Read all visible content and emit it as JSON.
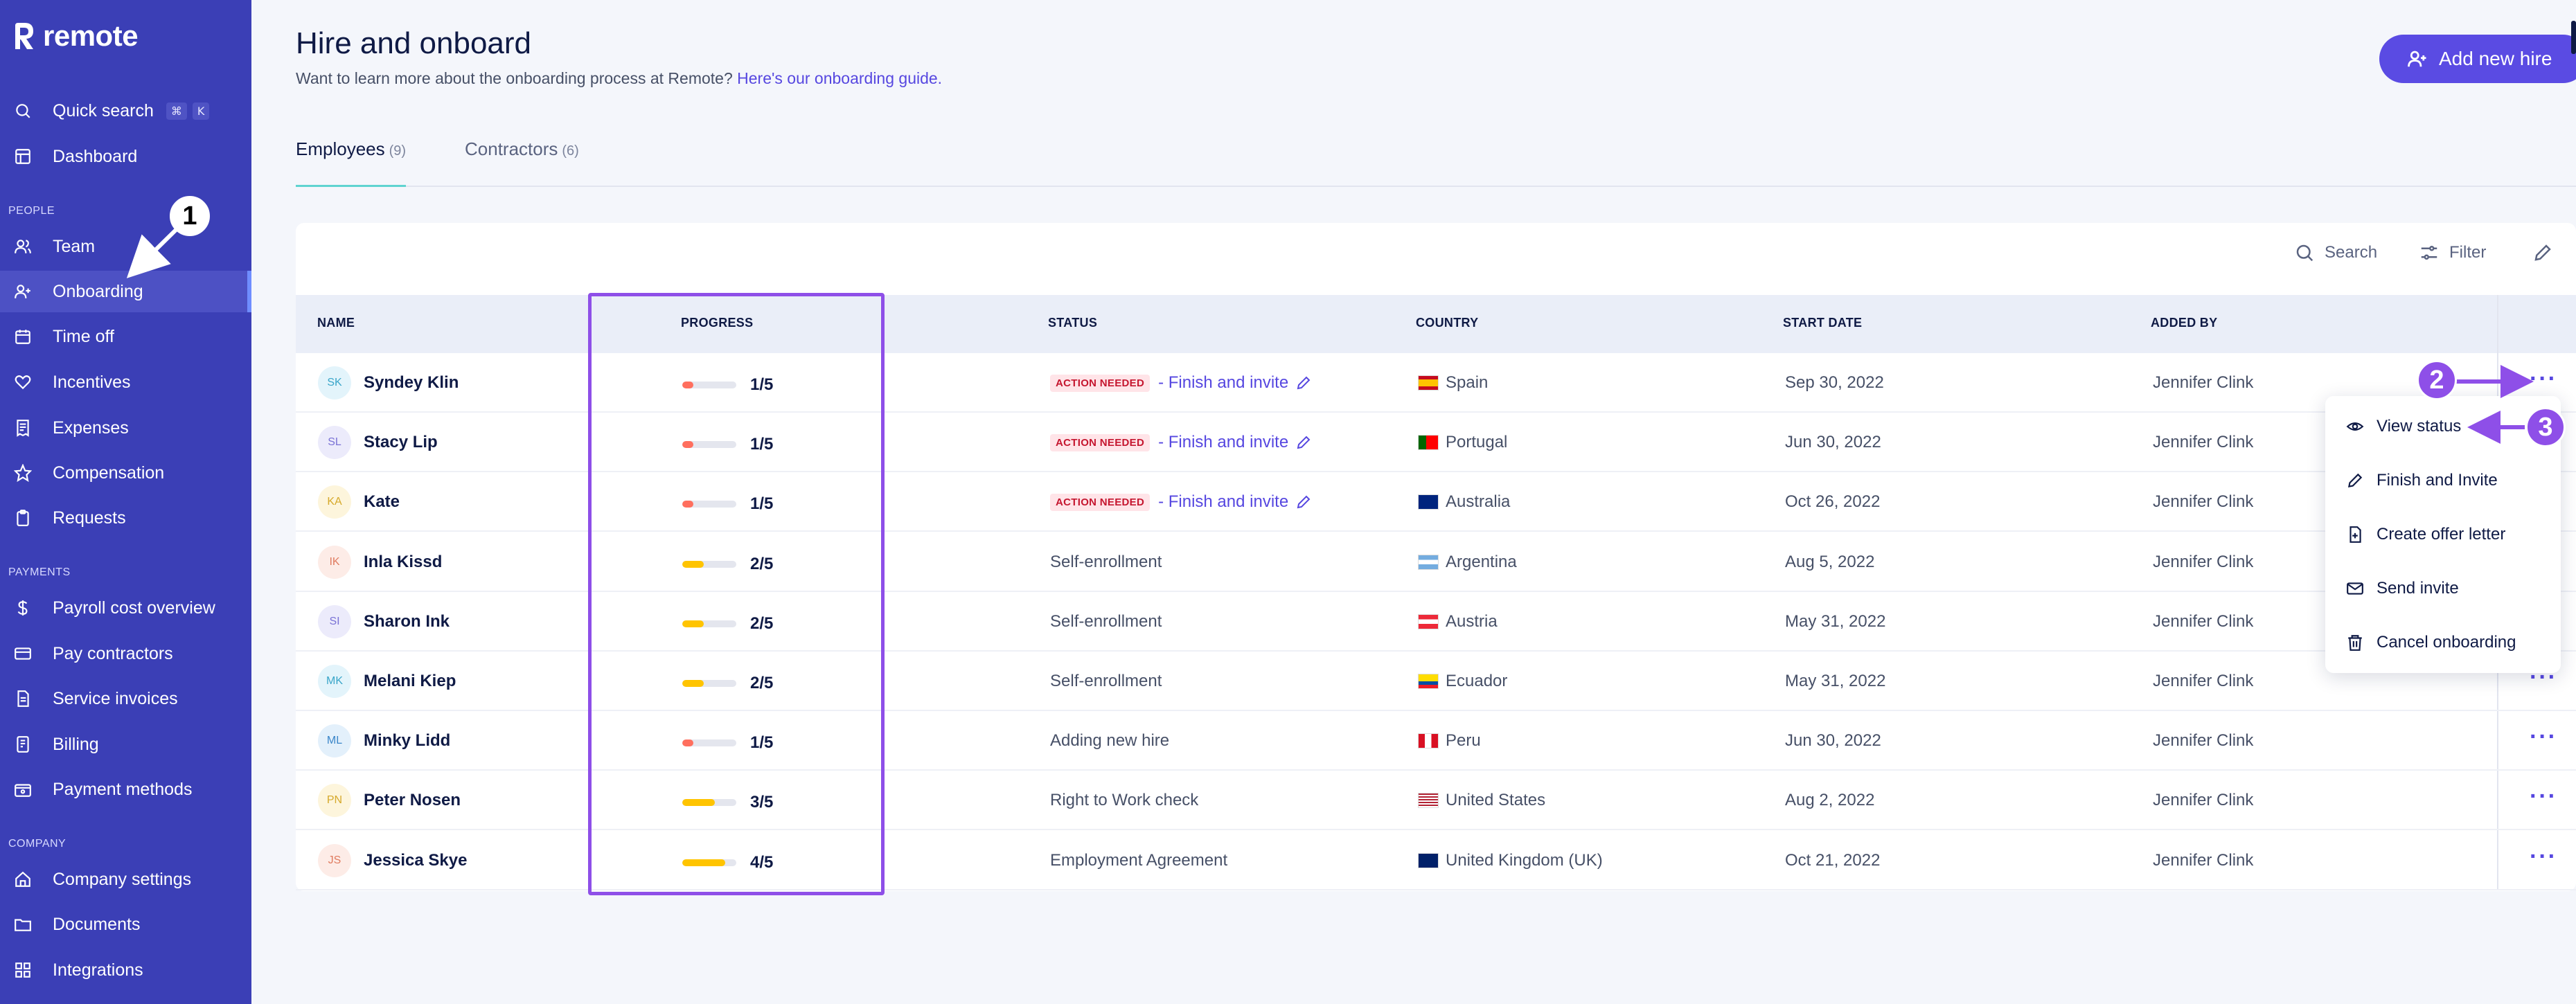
{
  "brand": {
    "name": "remote",
    "sidebar_color": "#3b3fb6",
    "accent": "#5a4be3",
    "annotation_color": "#8e4fe8"
  },
  "sidebar": {
    "quick_search": {
      "label": "Quick search",
      "keys": [
        "⌘",
        "K"
      ],
      "icon": "search-icon"
    },
    "top_items": [
      {
        "label": "Dashboard",
        "icon": "dashboard-icon"
      }
    ],
    "sections": [
      {
        "label": "PEOPLE",
        "items": [
          {
            "label": "Team",
            "icon": "team-icon"
          },
          {
            "label": "Onboarding",
            "icon": "user-plus-icon",
            "active": true
          },
          {
            "label": "Time off",
            "icon": "calendar-icon"
          },
          {
            "label": "Incentives",
            "icon": "heart-icon"
          },
          {
            "label": "Expenses",
            "icon": "receipt-icon"
          },
          {
            "label": "Compensation",
            "icon": "star-icon"
          },
          {
            "label": "Requests",
            "icon": "clipboard-icon"
          }
        ]
      },
      {
        "label": "PAYMENTS",
        "items": [
          {
            "label": "Payroll cost overview",
            "icon": "dollar-icon"
          },
          {
            "label": "Pay contractors",
            "icon": "card-icon"
          },
          {
            "label": "Service invoices",
            "icon": "invoice-icon"
          },
          {
            "label": "Billing",
            "icon": "billing-icon"
          },
          {
            "label": "Payment methods",
            "icon": "wallet-icon"
          }
        ]
      },
      {
        "label": "COMPANY",
        "items": [
          {
            "label": "Company settings",
            "icon": "home-icon"
          },
          {
            "label": "Documents",
            "icon": "folder-icon"
          },
          {
            "label": "Integrations",
            "icon": "grid-icon"
          }
        ]
      }
    ]
  },
  "header": {
    "title": "Hire and onboard",
    "subtitle_text": "Want to learn more about the onboarding process at Remote?",
    "subtitle_link": "Here's our onboarding guide.",
    "add_button": "Add new hire"
  },
  "tabs": [
    {
      "label": "Employees",
      "count": "(9)",
      "active": true
    },
    {
      "label": "Contractors",
      "count": "(6)",
      "active": false
    }
  ],
  "toolbar": {
    "search": "Search",
    "filter": "Filter"
  },
  "table": {
    "columns": [
      "NAME",
      "PROGRESS",
      "STATUS",
      "COUNTRY",
      "START DATE",
      "ADDED BY"
    ],
    "rows": [
      {
        "initials": "SK",
        "name": "Syndey Klin",
        "progress": "1/5",
        "progress_fraction": 0.2,
        "action_needed": true,
        "status": "- Finish and invite",
        "country": "Spain",
        "start": "Sep 30, 2022",
        "added_by": "Jennifer Clink",
        "avatar_bg": "#e3f4fb",
        "avatar_fg": "#3aa6c9"
      },
      {
        "initials": "SL",
        "name": "Stacy Lip",
        "progress": "1/5",
        "progress_fraction": 0.2,
        "action_needed": true,
        "status": "- Finish and invite",
        "country": "Portugal",
        "start": "Jun 30, 2022",
        "added_by": "Jennifer Clink",
        "avatar_bg": "#ecebfb",
        "avatar_fg": "#7a72d6"
      },
      {
        "initials": "KA",
        "name": "Kate",
        "progress": "1/5",
        "progress_fraction": 0.2,
        "action_needed": true,
        "status": "- Finish and invite",
        "country": "Australia",
        "start": "Oct 26, 2022",
        "added_by": "Jennifer Clink",
        "avatar_bg": "#fdf5dc",
        "avatar_fg": "#d6a92b"
      },
      {
        "initials": "IK",
        "name": "Inla Kissd",
        "progress": "2/5",
        "progress_fraction": 0.4,
        "action_needed": false,
        "status": "Self-enrollment",
        "country": "Argentina",
        "start": "Aug 5, 2022",
        "added_by": "Jennifer Clink",
        "avatar_bg": "#fdece7",
        "avatar_fg": "#e07b5f"
      },
      {
        "initials": "SI",
        "name": "Sharon Ink",
        "progress": "2/5",
        "progress_fraction": 0.4,
        "action_needed": false,
        "status": "Self-enrollment",
        "country": "Austria",
        "start": "May 31, 2022",
        "added_by": "Jennifer Clink",
        "avatar_bg": "#ecebfb",
        "avatar_fg": "#7a72d6"
      },
      {
        "initials": "MK",
        "name": "Melani Kiep",
        "progress": "2/5",
        "progress_fraction": 0.4,
        "action_needed": false,
        "status": "Self-enrollment",
        "country": "Ecuador",
        "start": "May 31, 2022",
        "added_by": "Jennifer Clink",
        "avatar_bg": "#e3f4fb",
        "avatar_fg": "#3aa6c9"
      },
      {
        "initials": "ML",
        "name": "Minky Lidd",
        "progress": "1/5",
        "progress_fraction": 0.2,
        "action_needed": false,
        "status": "Adding new hire",
        "country": "Peru",
        "start": "Jun 30, 2022",
        "added_by": "Jennifer Clink",
        "avatar_bg": "#e3f0fb",
        "avatar_fg": "#3a86c9"
      },
      {
        "initials": "PN",
        "name": "Peter Nosen",
        "progress": "3/5",
        "progress_fraction": 0.6,
        "action_needed": false,
        "status": "Right to Work check",
        "country": "United States",
        "start": "Aug 2, 2022",
        "added_by": "Jennifer Clink",
        "avatar_bg": "#fdf5dc",
        "avatar_fg": "#d6a92b"
      },
      {
        "initials": "JS",
        "name": "Jessica Skye",
        "progress": "4/5",
        "progress_fraction": 0.8,
        "action_needed": false,
        "status": "Employment Agreement",
        "country": "United Kingdom (UK)",
        "start": "Oct 21, 2022",
        "added_by": "Jennifer Clink",
        "avatar_bg": "#fdece7",
        "avatar_fg": "#e07b5f"
      }
    ],
    "action_badge": "ACTION NEEDED"
  },
  "row_menu": {
    "items": [
      {
        "label": "View status",
        "icon": "eye-icon"
      },
      {
        "label": "Finish and Invite",
        "icon": "pencil-icon"
      },
      {
        "label": "Create offer letter",
        "icon": "file-plus-icon"
      },
      {
        "label": "Send invite",
        "icon": "mail-icon"
      },
      {
        "label": "Cancel onboarding",
        "icon": "trash-icon"
      }
    ]
  },
  "annotations": {
    "callout_1": "1",
    "callout_2": "2",
    "callout_3": "3"
  }
}
